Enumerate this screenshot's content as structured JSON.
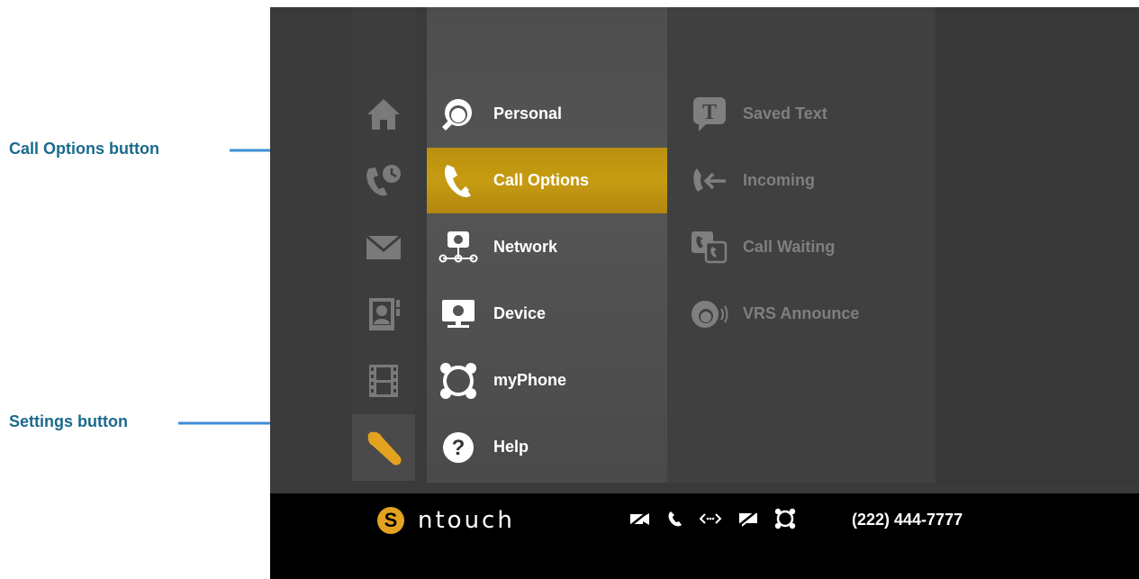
{
  "callouts": {
    "call_options": "Call Options button",
    "settings": "Settings button"
  },
  "iconbar": {
    "items": [
      {
        "icon": "home-icon"
      },
      {
        "icon": "call-history-icon"
      },
      {
        "icon": "mail-icon"
      },
      {
        "icon": "contacts-icon"
      },
      {
        "icon": "video-film-icon"
      },
      {
        "icon": "wrench-icon",
        "active": true
      }
    ]
  },
  "menu": {
    "items": [
      {
        "label": "Personal",
        "icon": "personal-settings-icon"
      },
      {
        "label": "Call Options",
        "icon": "call-options-icon",
        "selected": true
      },
      {
        "label": "Network",
        "icon": "network-icon"
      },
      {
        "label": "Device",
        "icon": "device-icon"
      },
      {
        "label": "myPhone",
        "icon": "myphone-icon"
      },
      {
        "label": "Help",
        "icon": "help-icon"
      }
    ]
  },
  "submenu": {
    "items": [
      {
        "label": "Saved Text",
        "icon": "saved-text-icon"
      },
      {
        "label": "Incoming",
        "icon": "incoming-call-icon"
      },
      {
        "label": "Call Waiting",
        "icon": "call-waiting-icon"
      },
      {
        "label": "VRS Announce",
        "icon": "vrs-announce-icon"
      }
    ]
  },
  "statusbar": {
    "brand": "ntouch",
    "phone_number": "(222) 444-7777",
    "icons": [
      "video-privacy-off-icon",
      "phone-icon",
      "network-arrows-icon",
      "message-off-icon",
      "myphone-ring-icon"
    ]
  },
  "colors": {
    "accent_gold": "#c79c12",
    "callout_blue": "#1b6a8c",
    "arrow_blue": "#3f8fd8"
  }
}
